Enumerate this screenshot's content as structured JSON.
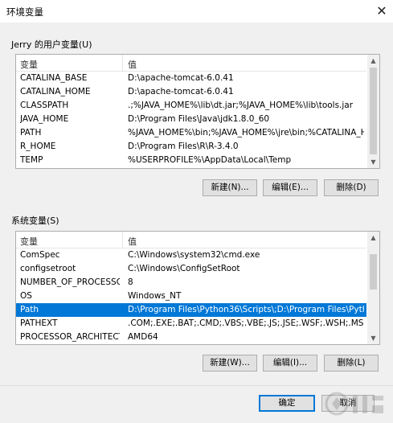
{
  "window": {
    "title": "环境变量",
    "close_icon": "close-icon"
  },
  "user_vars": {
    "group_label": "Jerry 的用户变量(U)",
    "columns": [
      "变量",
      "值"
    ],
    "rows": [
      [
        "CATALINA_BASE",
        "D:\\apache-tomcat-6.0.41"
      ],
      [
        "CATALINA_HOME",
        "D:\\apache-tomcat-6.0.41"
      ],
      [
        "CLASSPATH",
        ".;%JAVA_HOME%\\lib\\dt.jar;%JAVA_HOME%\\lib\\tools.jar"
      ],
      [
        "JAVA_HOME",
        "D:\\Program Files\\Java\\jdk1.8.0_60"
      ],
      [
        "PATH",
        "%JAVA_HOME%\\bin;%JAVA_HOME%\\jre\\bin;%CATALINA_HO..."
      ],
      [
        "R_HOME",
        "D:\\Program Files\\R\\R-3.4.0"
      ],
      [
        "TEMP",
        "%USERPROFILE%\\AppData\\Local\\Temp"
      ]
    ],
    "buttons": {
      "new": "新建(N)...",
      "edit": "编辑(E)...",
      "delete": "删除(D)"
    }
  },
  "system_vars": {
    "group_label": "系统变量(S)",
    "columns": [
      "变量",
      "值"
    ],
    "rows": [
      [
        "ComSpec",
        "C:\\Windows\\system32\\cmd.exe"
      ],
      [
        "configsetroot",
        "C:\\Windows\\ConfigSetRoot"
      ],
      [
        "NUMBER_OF_PROCESSORS",
        "8"
      ],
      [
        "OS",
        "Windows_NT"
      ],
      [
        "Path",
        "D:\\Program Files\\Python36\\Scripts\\;D:\\Program Files\\Python3..."
      ],
      [
        "PATHEXT",
        ".COM;.EXE;.BAT;.CMD;.VBS;.VBE;.JS;.JSE;.WSF;.WSH;.MSC;.PY;.P..."
      ],
      [
        "PROCESSOR_ARCHITECT...",
        "AMD64"
      ]
    ],
    "selected_index": 4,
    "buttons": {
      "new": "新建(W)...",
      "edit": "编辑(I)...",
      "delete": "删除(L)"
    }
  },
  "footer": {
    "ok": "确定",
    "cancel": "取消"
  },
  "colors": {
    "selection": "#0078d7",
    "default_button_border": "#0078d7"
  }
}
